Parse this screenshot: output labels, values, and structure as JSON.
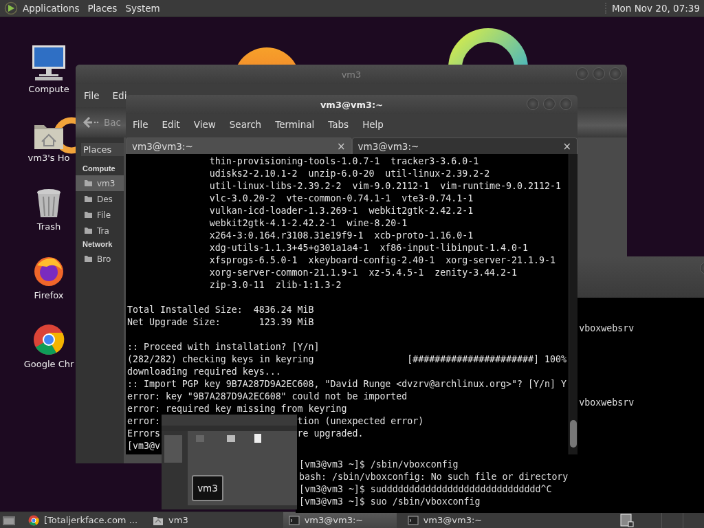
{
  "top_panel": {
    "menus": [
      "Applications",
      "Places",
      "System"
    ],
    "clock": "Mon Nov 20, 07:39"
  },
  "desktop_icons": [
    {
      "kind": "computer",
      "label": "Compute"
    },
    {
      "kind": "home",
      "label": "vm3's Ho"
    },
    {
      "kind": "trash",
      "label": "Trash"
    },
    {
      "kind": "firefox",
      "label": "Firefox"
    },
    {
      "kind": "chrome",
      "label": "Google Chr"
    }
  ],
  "file_manager": {
    "title": "vm3",
    "menus": [
      "File",
      "Edi"
    ],
    "back": "Bac",
    "places_label": "Places",
    "sections": [
      {
        "title": "Compute",
        "items": [
          {
            "label": "vm3",
            "selected": true
          },
          {
            "label": "Des",
            "selected": false
          },
          {
            "label": "File",
            "selected": false
          },
          {
            "label": "Tra",
            "selected": false
          }
        ]
      },
      {
        "title": "Network",
        "items": [
          {
            "label": "Bro",
            "selected": false
          }
        ]
      }
    ]
  },
  "back_terminal": {
    "blocks": [
      [
        {
          "rest": "vboxwebsrv"
        }
      ],
      [
        {
          "rest": "vboxwebsrv"
        }
      ],
      [
        {
          "text": "[vm3@vm3 ~]$ /sbin/vboxconfig"
        },
        {
          "text": "bash: /sbin/vboxconfig: No such file or directory"
        },
        {
          "text": "[vm3@vm3 ~]$ suddddddddddddddddddddddddddddd^C"
        },
        {
          "text": "[vm3@vm3 ~]$ suo /sbin/vboxconfig"
        }
      ]
    ]
  },
  "terminal": {
    "title": "vm3@vm3:~",
    "menus": [
      "File",
      "Edit",
      "View",
      "Search",
      "Terminal",
      "Tabs",
      "Help"
    ],
    "tabs": [
      {
        "label": "vm3@vm3:~",
        "close": "×",
        "selected": true
      },
      {
        "label": "vm3@vm3:~",
        "close": "×",
        "selected": false
      }
    ],
    "blocks": [
      [
        {
          "text": "               thin-provisioning-tools-1.0.7-1  tracker3-3.6.0-1"
        },
        {
          "text": "               udisks2-2.10.1-2  unzip-6.0-20  util-linux-2.39.2-2"
        },
        {
          "text": "               util-linux-libs-2.39.2-2  vim-9.0.2112-1  vim-runtime-9.0.2112-1"
        },
        {
          "text": "               vlc-3.0.20-2  vte-common-0.74.1-1  vte3-0.74.1-1"
        },
        {
          "text": "               vulkan-icd-loader-1.3.269-1  webkit2gtk-2.42.2-1"
        },
        {
          "text": "               webkit2gtk-4.1-2.42.2-1  wine-8.20-1"
        },
        {
          "text": "               x264-3:0.164.r3108.31e19f9-1  xcb-proto-1.16.0-1"
        },
        {
          "text": "               xdg-utils-1.1.3+45+g301a1a4-1  xf86-input-libinput-1.4.0-1"
        },
        {
          "text": "               xfsprogs-6.5.0-1  xkeyboard-config-2.40-1  xorg-server-21.1.9-1"
        },
        {
          "text": "               xorg-server-common-21.1.9-1  xz-5.4.5-1  zenity-3.44.2-1"
        },
        {
          "text": "               zip-3.0-11  zlib-1:1.3-2"
        }
      ],
      [
        {
          "text": "Total Installed Size:  4836.24 MiB"
        },
        {
          "text": "Net Upgrade Size:       123.39 MiB"
        }
      ],
      [
        {
          "text": ":: Proceed with installation? [Y/n]"
        },
        {
          "text": "(282/282) checking keys in keyring                 [######################] 100%"
        },
        {
          "text": "downloading required keys..."
        },
        {
          "text": ":: Import PGP key 9B7A287D9A2EC608, \"David Runge <dvzrv@archlinux.org>\"? [Y/n] Y"
        },
        {
          "text": "error: key \"9B7A287D9A2EC608\" could not be imported"
        },
        {
          "text": "error: required key missing from keyring"
        },
        {
          "text": "error:",
          "rest": "tion (unexpected error)"
        },
        {
          "text": "Errors",
          "rest": "re upgraded."
        },
        {
          "text": "[vm3@v"
        }
      ]
    ]
  },
  "window_preview": {
    "label": "vm3"
  },
  "taskbar": {
    "items": [
      {
        "kind": "chrome",
        "label": "[Totaljerkface.com ...",
        "selected": false
      },
      {
        "kind": "home",
        "label": "vm3",
        "selected": false
      },
      {
        "kind": "terminal",
        "label": "vm3@vm3:~",
        "selected": true
      },
      {
        "kind": "terminal",
        "label": "vm3@vm3:~",
        "selected": false
      }
    ]
  }
}
